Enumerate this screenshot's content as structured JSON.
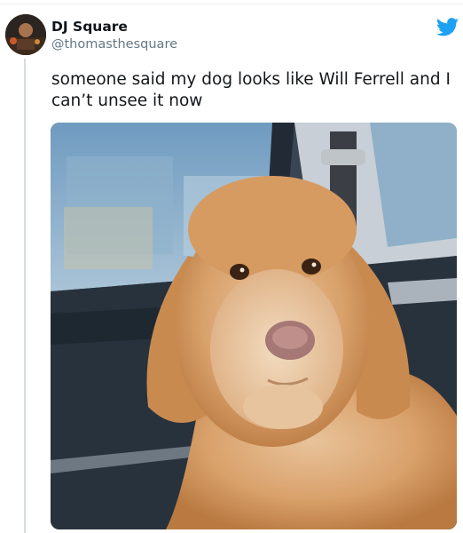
{
  "user": {
    "display_name": "DJ Square",
    "handle": "@thomasthesquare"
  },
  "tweet": {
    "text": "someone said my dog looks like Will Ferrell and I can’t unsee it now"
  },
  "icons": {
    "brand": "twitter-bird-icon",
    "brand_color": "#1da1f2"
  }
}
